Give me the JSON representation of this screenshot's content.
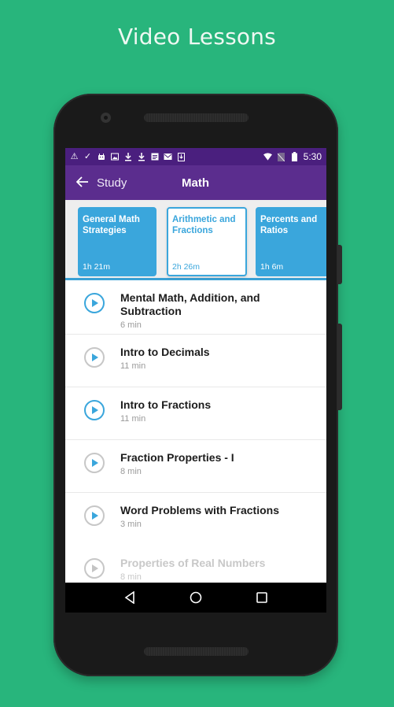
{
  "headline": "Video Lessons",
  "status_bar": {
    "left_icons": [
      "warning-icon",
      "check-icon",
      "android-icon",
      "image-icon",
      "download-icon",
      "download-icon",
      "document-icon",
      "gmail-icon",
      "download-box-icon"
    ],
    "right_icons": [
      "wifi-icon",
      "no-sim-icon",
      "battery-icon"
    ],
    "time": "5:30"
  },
  "toolbar": {
    "back_label": "Study",
    "title": "Math"
  },
  "courses": [
    {
      "title": "General Math Strategies",
      "duration": "1h 21m",
      "selected": false
    },
    {
      "title": "Arithmetic and Fractions",
      "duration": "2h 26m",
      "selected": true
    },
    {
      "title": "Percents and Ratios",
      "duration": "1h 6m",
      "selected": false
    }
  ],
  "lessons": [
    {
      "title": "Mental Math, Addition, and Subtraction",
      "duration": "6 min",
      "state": "active"
    },
    {
      "title": "Intro to Decimals",
      "duration": "11 min",
      "state": "normal"
    },
    {
      "title": "Intro to Fractions",
      "duration": "11 min",
      "state": "active"
    },
    {
      "title": "Fraction Properties - I",
      "duration": "8 min",
      "state": "normal"
    },
    {
      "title": "Word Problems with Fractions",
      "duration": "3 min",
      "state": "normal"
    },
    {
      "title": "Properties of Real Numbers",
      "duration": "8 min",
      "state": "faded"
    }
  ],
  "nav": [
    "back-nav",
    "home-nav",
    "recents-nav"
  ],
  "colors": {
    "background": "#28b57c",
    "toolbar": "#5b2d8e",
    "statusbar": "#4a1f7e",
    "accent": "#3aa6dc"
  }
}
